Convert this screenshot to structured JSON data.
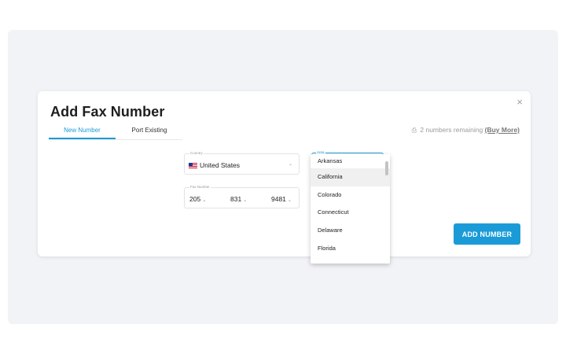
{
  "modal": {
    "title": "Add Fax Number",
    "close_glyph": "×",
    "tabs": [
      {
        "label": "New Number",
        "active": true
      },
      {
        "label": "Port Existing",
        "active": false
      }
    ],
    "remaining": {
      "icon": "fax-icon",
      "text": "2 numbers remaining",
      "link": "(Buy More)"
    },
    "country": {
      "label": "Country",
      "value": "United States",
      "flag": "us-flag-icon"
    },
    "fax_number": {
      "label": "Fax Number",
      "area_code": "205",
      "prefix": "831",
      "line": "9481"
    },
    "area": {
      "label": "Area",
      "options": [
        "Arkansas",
        "California",
        "Colorado",
        "Connecticut",
        "Delaware",
        "Florida"
      ],
      "highlighted": "California"
    },
    "add_button": "ADD NUMBER",
    "colors": {
      "accent": "#1a9bd8",
      "backdrop": "#f1f3f6"
    }
  }
}
